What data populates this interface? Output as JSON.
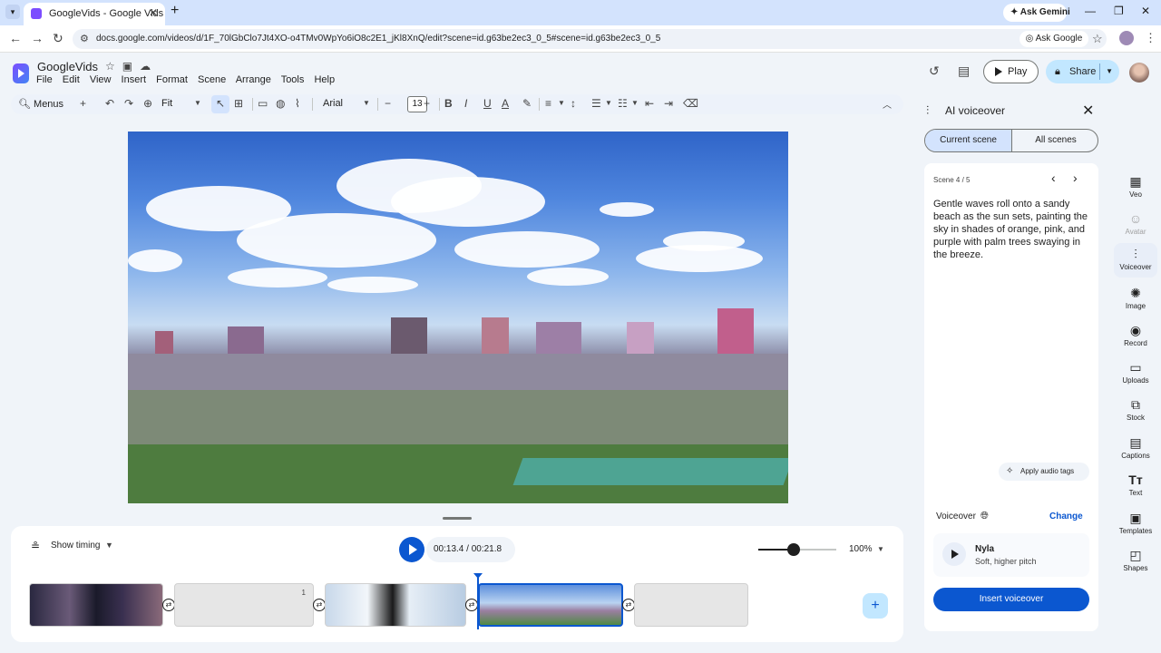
{
  "browser": {
    "tab_title": "GoogleVids - Google Vids",
    "ask_gemini": "Ask Gemini",
    "url": "docs.google.com/videos/d/1F_70lGbClo7Jt4XO-o4TMv0WpYo6iO8c2E1_jKl8XnQ/edit?scene=id.g63be2ec3_0_5#scene=id.g63be2ec3_0_5",
    "ask_google": "Ask Google"
  },
  "app": {
    "title": "GoogleVids",
    "menu": [
      "File",
      "Edit",
      "View",
      "Insert",
      "Format",
      "Scene",
      "Arrange",
      "Tools",
      "Help"
    ],
    "play_label": "Play",
    "share_label": "Share"
  },
  "toolbar": {
    "menus_label": "Menus",
    "zoom_select": "Fit",
    "font_select": "Arial",
    "font_size": "13"
  },
  "timeline": {
    "show_timing": "Show timing",
    "time_readout": "00:13.4 / 00:21.8",
    "zoom_label": "100%",
    "zoom_level": 0.45,
    "clip_badge": "1"
  },
  "panel": {
    "title": "AI voiceover",
    "tabs": [
      "Current scene",
      "All scenes"
    ],
    "scene_counter": "Scene 4 / 5",
    "script": "Gentle waves roll onto a sandy beach as the sun sets, painting the sky in shades of orange, pink, and purple with palm trees swaying in the breeze.",
    "apply_audio_tags": "Apply audio tags",
    "voiceover_label": "Voiceover",
    "change_label": "Change",
    "voice_name": "Nyla",
    "voice_description": "Soft, higher pitch",
    "insert_button": "Insert voiceover"
  },
  "rail": [
    {
      "label": "Veo",
      "icon": "veo-icon"
    },
    {
      "label": "Avatar",
      "icon": "avatar-icon"
    },
    {
      "label": "Voiceover",
      "icon": "voiceover-icon"
    },
    {
      "label": "Image",
      "icon": "image-icon"
    },
    {
      "label": "Record",
      "icon": "record-icon"
    },
    {
      "label": "Uploads",
      "icon": "uploads-icon"
    },
    {
      "label": "Stock",
      "icon": "stock-icon"
    },
    {
      "label": "Captions",
      "icon": "captions-icon"
    },
    {
      "label": "Text",
      "icon": "text-icon"
    },
    {
      "label": "Templates",
      "icon": "templates-icon"
    },
    {
      "label": "Shapes",
      "icon": "shapes-icon"
    }
  ],
  "colors": {
    "accent": "#0b57d0",
    "selected_tab": "#d3e3fd",
    "share_button": "#c2e7ff"
  }
}
